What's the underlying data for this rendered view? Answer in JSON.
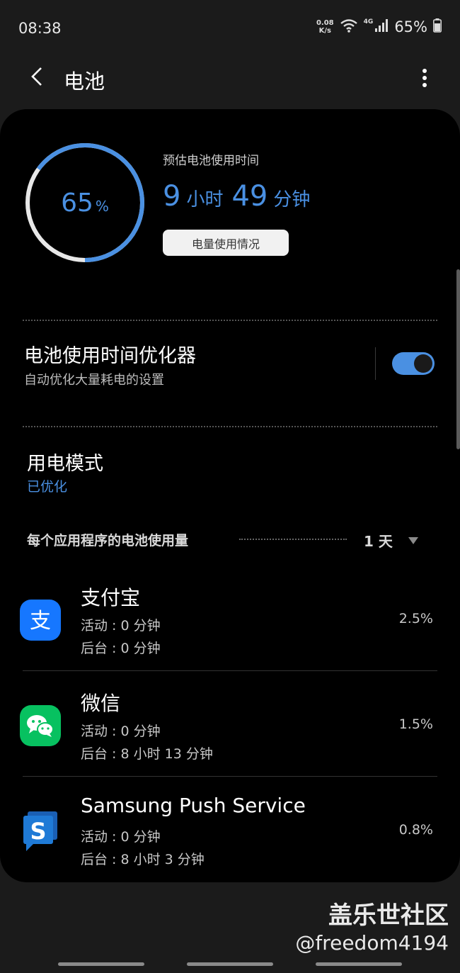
{
  "status_bar": {
    "time": "08:38",
    "net_speed_value": "0.08",
    "net_speed_unit": "K/s",
    "signal_type": "4G",
    "battery_pct": "65%"
  },
  "header": {
    "title": "电池"
  },
  "battery": {
    "level_value": "65",
    "level_unit": "%",
    "level_fraction": 0.65,
    "estimate_label": "预估电池使用时间",
    "hours": "9",
    "hours_unit": "小时",
    "minutes": "49",
    "minutes_unit": "分钟",
    "usage_button": "电量使用情况"
  },
  "optimizer": {
    "title": "电池使用时间优化器",
    "subtitle": "自动优化大量耗电的设置",
    "enabled": true
  },
  "power_mode": {
    "title": "用电模式",
    "value": "已优化"
  },
  "per_app": {
    "label": "每个应用程序的电池使用量",
    "period": "1 天",
    "apps": [
      {
        "name": "支付宝",
        "active": "活动 : 0 分钟",
        "background": "后台 : 0 分钟",
        "percent": "2.5%",
        "icon": "alipay-icon",
        "color": "#1677ff"
      },
      {
        "name": "微信",
        "active": "活动 : 0 分钟",
        "background": "后台 : 8 小时 13 分钟",
        "percent": "1.5%",
        "icon": "wechat-icon",
        "color": "#07c160"
      },
      {
        "name": "Samsung Push Service",
        "active": "活动 : 0 分钟",
        "background": "后台 : 8 小时 3 分钟",
        "percent": "0.8%",
        "icon": "samsung-push-icon",
        "color": "#1a5fb4"
      }
    ]
  },
  "watermark": {
    "line1": "盖乐世社区",
    "line2": "@freedom4194"
  },
  "colors": {
    "accent": "#4a90e2",
    "card_bg": "#000000",
    "page_bg": "#1b1b1b"
  }
}
